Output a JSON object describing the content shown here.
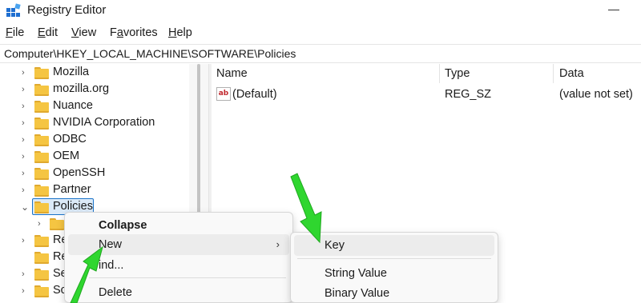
{
  "window": {
    "title": "Registry Editor",
    "app_icon": "registry-editor-icon"
  },
  "menubar": [
    {
      "label": "File",
      "mnemonic": "F",
      "rest": "ile"
    },
    {
      "label": "Edit",
      "mnemonic": "E",
      "rest": "dit"
    },
    {
      "label": "View",
      "mnemonic": "V",
      "rest": "iew"
    },
    {
      "label": "Favorites",
      "mnemonic": "a",
      "pre": "F",
      "rest": "vorites"
    },
    {
      "label": "Help",
      "mnemonic": "H",
      "rest": "elp"
    }
  ],
  "address": {
    "path": "Computer\\HKEY_LOCAL_MACHINE\\SOFTWARE\\Policies"
  },
  "tree": {
    "items": [
      {
        "label": "Mozilla",
        "expanded": false
      },
      {
        "label": "mozilla.org",
        "expanded": false
      },
      {
        "label": "Nuance",
        "expanded": false
      },
      {
        "label": "NVIDIA Corporation",
        "expanded": false
      },
      {
        "label": "ODBC",
        "expanded": false
      },
      {
        "label": "OEM",
        "expanded": false
      },
      {
        "label": "OpenSSH",
        "expanded": false
      },
      {
        "label": "Partner",
        "expanded": false
      },
      {
        "label": "Policies",
        "expanded": true,
        "selected": true
      },
      {
        "label": "",
        "expanded": false
      },
      {
        "label": "Re",
        "expanded": false
      },
      {
        "label": "Re",
        "expanded": false
      },
      {
        "label": "Se",
        "expanded": false
      },
      {
        "label": "Sc",
        "expanded": false
      }
    ]
  },
  "values": {
    "columns": [
      "Name",
      "Type",
      "Data"
    ],
    "rows": [
      {
        "name": "(Default)",
        "type": "REG_SZ",
        "data": "(value not set)",
        "icon": "string-value-icon"
      }
    ]
  },
  "context_menu": {
    "items": [
      {
        "label": "Collapse",
        "bold": true
      },
      {
        "label": "New",
        "submenu": true,
        "hover": true
      },
      {
        "label": "ind..."
      },
      {
        "label": "Delete"
      }
    ]
  },
  "submenu": {
    "items": [
      {
        "label": "Key",
        "hover": true
      },
      {
        "label": "String Value"
      },
      {
        "label": "Binary Value"
      }
    ]
  },
  "colors": {
    "annotation_arrow": "#2fd62f",
    "selection": "#1a73c8",
    "folder": "#f5c542"
  }
}
